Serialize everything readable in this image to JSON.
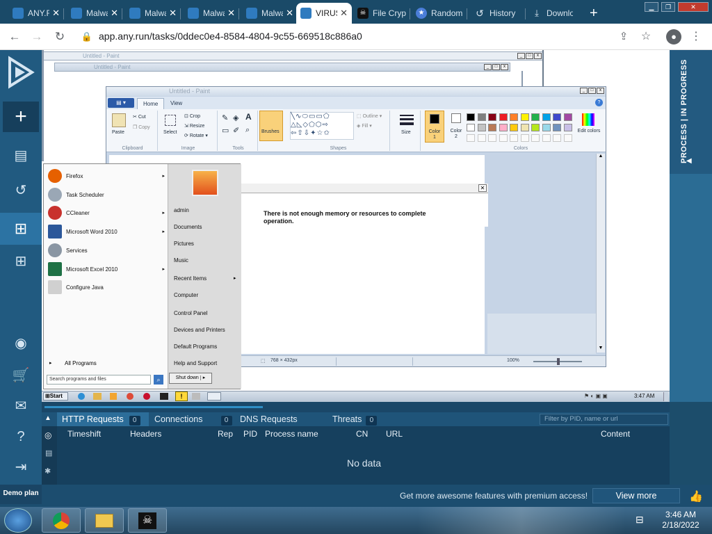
{
  "browser": {
    "tabs": [
      {
        "label": "ANY.RUN",
        "fav_color": "#1f6fb2"
      },
      {
        "label": "Malware",
        "fav_color": "#1f6fb2"
      },
      {
        "label": "Malware",
        "fav_color": "#1f6fb2"
      },
      {
        "label": "Malware",
        "fav_color": "#1f6fb2"
      },
      {
        "label": "Malware",
        "fav_color": "#1f6fb2"
      },
      {
        "label": "VIRUS",
        "fav_color": "#1f6fb2"
      },
      {
        "label": "File Crypt",
        "fav_color": "#222222"
      },
      {
        "label": "Random",
        "fav_color": "#4285f4"
      },
      {
        "label": "History",
        "fav_color": "#5f6368"
      },
      {
        "label": "Downloads",
        "fav_color": "#5f6368"
      }
    ],
    "new_tab": "+",
    "url": "app.any.run/tasks/0ddec0e4-8584-4804-9c55-669518c886a0"
  },
  "sidebar": {
    "demo_plan": "Demo plan"
  },
  "right_panel": {
    "status": "PROCESS | IN PROGRESS"
  },
  "vm": {
    "bg_window_title_1": "Untitled - Paint",
    "bg_window_title_2": "Untitled - Paint",
    "paint": {
      "title": "Untitled - Paint",
      "tabs": [
        "Home",
        "View"
      ],
      "clipboard": {
        "paste": "Paste",
        "cut": "Cut",
        "copy": "Copy",
        "label": "Clipboard"
      },
      "image": {
        "select": "Select",
        "crop": "Crop",
        "resize": "Resize",
        "rotate": "Rotate",
        "label": "Image"
      },
      "tools_label": "Tools",
      "brushes": "Brushes",
      "shapes": {
        "outline": "Outline",
        "fill": "Fill",
        "label": "Shapes"
      },
      "size": "Size",
      "color1": "Color 1",
      "color2": "Color 2",
      "colors_label": "Colors",
      "edit_colors": "Edit colors",
      "palette_row1": [
        "#000000",
        "#7f7f7f",
        "#880015",
        "#ed1c24",
        "#ff7f27",
        "#fff200",
        "#22b14c",
        "#00a2e8",
        "#3f48cc",
        "#a349a4"
      ],
      "palette_row2": [
        "#ffffff",
        "#c3c3c3",
        "#b97a57",
        "#ffaec9",
        "#ffc90e",
        "#efe4b0",
        "#b5e61d",
        "#99d9ea",
        "#7092be",
        "#c8bfe7"
      ],
      "status_size": "768 × 432px",
      "zoom": "100%"
    },
    "error_message": "There is not enough memory or resources to complete operation.",
    "start_menu": {
      "programs": [
        {
          "label": "Firefox",
          "color": "#e66000",
          "arrow": true
        },
        {
          "label": "Task Scheduler",
          "color": "#9aa7b5",
          "arrow": false
        },
        {
          "label": "CCleaner",
          "color": "#c8322d",
          "arrow": true
        },
        {
          "label": "Microsoft Word 2010",
          "color": "#2b579a",
          "arrow": true
        },
        {
          "label": "Services",
          "color": "#8a96a3",
          "arrow": false
        },
        {
          "label": "Microsoft Excel 2010",
          "color": "#1e7145",
          "arrow": true
        },
        {
          "label": "Configure Java",
          "color": "#d0d0d0",
          "arrow": false
        }
      ],
      "all_programs": "All Programs",
      "search_placeholder": "Search programs and files",
      "right_items": [
        "admin",
        "Documents",
        "Pictures",
        "Music",
        "Recent Items",
        "Computer",
        "Control Panel",
        "Devices and Printers",
        "Default Programs",
        "Help and Support"
      ],
      "shutdown": "Shut down"
    },
    "taskbar": {
      "start": "Start",
      "clock": "3:47 AM"
    }
  },
  "bottom_panel": {
    "tabs": [
      {
        "label": "HTTP Requests",
        "count": "0"
      },
      {
        "label": "Connections",
        "count": "0"
      },
      {
        "label": "DNS Requests",
        "count": "0"
      },
      {
        "label": "Threats",
        "count": "0"
      }
    ],
    "filter_placeholder": "Filter by PID, name or url",
    "columns": [
      "Timeshift",
      "Headers",
      "Rep",
      "PID",
      "Process name",
      "CN",
      "URL",
      "Content"
    ],
    "no_data": "No data",
    "promo": "Get more awesome features with premium access!",
    "view_more": "View more"
  },
  "host_taskbar": {
    "time": "3:46 AM",
    "date": "2/18/2022"
  }
}
